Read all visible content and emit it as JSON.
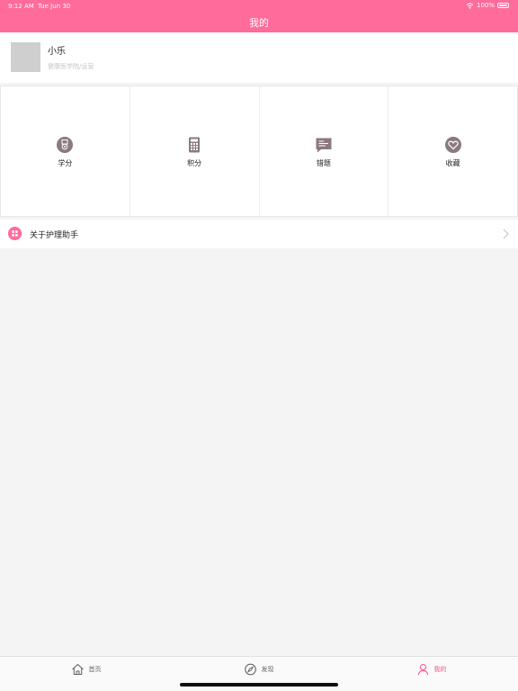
{
  "status_bar": {
    "time": "9:12 AM",
    "date": "Tue Jun 30",
    "battery": "100%"
  },
  "nav": {
    "title": "我的"
  },
  "profile": {
    "name": "小乐",
    "subtitle": "健康医学院/运营"
  },
  "grid": [
    {
      "label": "学分",
      "icon": "medal-icon"
    },
    {
      "label": "积分",
      "icon": "calculator-icon"
    },
    {
      "label": "错题",
      "icon": "notes-icon"
    },
    {
      "label": "收藏",
      "icon": "heart-icon"
    }
  ],
  "menu": {
    "about_label": "关于护理助手",
    "about_icon": "grid-icon",
    "chevron": "chevron-right-icon"
  },
  "tabs": [
    {
      "label": "首页",
      "icon": "home-icon",
      "active": false
    },
    {
      "label": "发现",
      "icon": "compass-icon",
      "active": false
    },
    {
      "label": "我的",
      "icon": "person-icon",
      "active": true
    }
  ],
  "colors": {
    "accent": "#ff6b9a",
    "icon_gray": "#8a7a80",
    "active_tab": "#ff4f8b"
  }
}
